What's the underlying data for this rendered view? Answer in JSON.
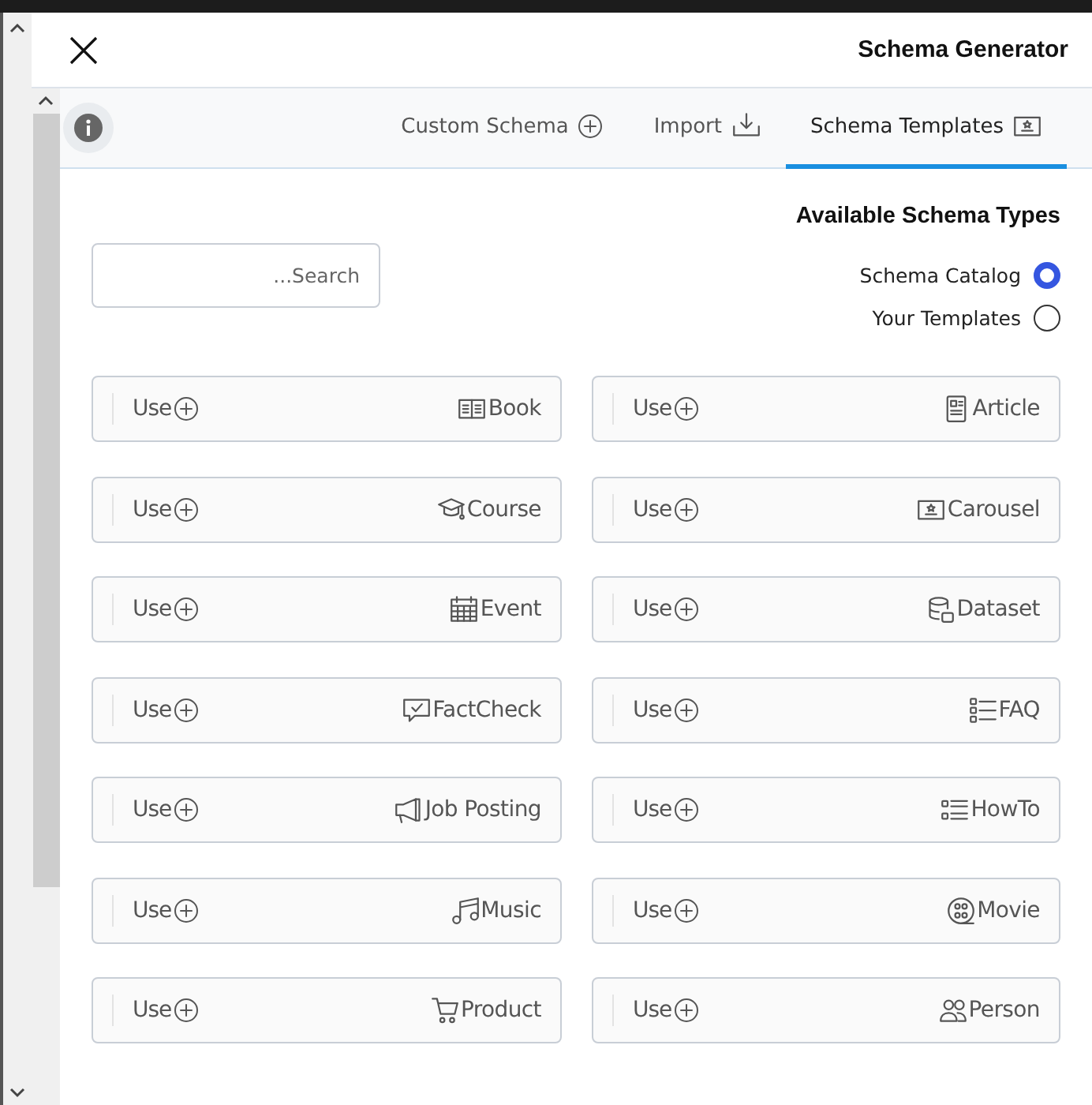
{
  "window": {
    "title": "Schema Generator"
  },
  "tabs": [
    {
      "label": "Custom Schema",
      "selected": false
    },
    {
      "label": "Import",
      "selected": false
    },
    {
      "label": "Schema Templates",
      "selected": true
    }
  ],
  "section": {
    "title": "Available Schema Types"
  },
  "search": {
    "placeholder": "...Search"
  },
  "sources": [
    {
      "label": "Schema Catalog",
      "selected": true
    },
    {
      "label": "Your Templates",
      "selected": false
    }
  ],
  "schema_types": [
    {
      "label": "Book",
      "action": "Use"
    },
    {
      "label": "Article",
      "action": "Use"
    },
    {
      "label": "Course",
      "action": "Use"
    },
    {
      "label": "Carousel",
      "action": "Use"
    },
    {
      "label": "Event",
      "action": "Use"
    },
    {
      "label": "Dataset",
      "action": "Use"
    },
    {
      "label": "FactCheck",
      "action": "Use"
    },
    {
      "label": "FAQ",
      "action": "Use"
    },
    {
      "label": "Job Posting",
      "action": "Use"
    },
    {
      "label": "HowTo",
      "action": "Use"
    },
    {
      "label": "Music",
      "action": "Use"
    },
    {
      "label": "Movie",
      "action": "Use"
    },
    {
      "label": "Product",
      "action": "Use"
    },
    {
      "label": "Person",
      "action": "Use"
    }
  ]
}
